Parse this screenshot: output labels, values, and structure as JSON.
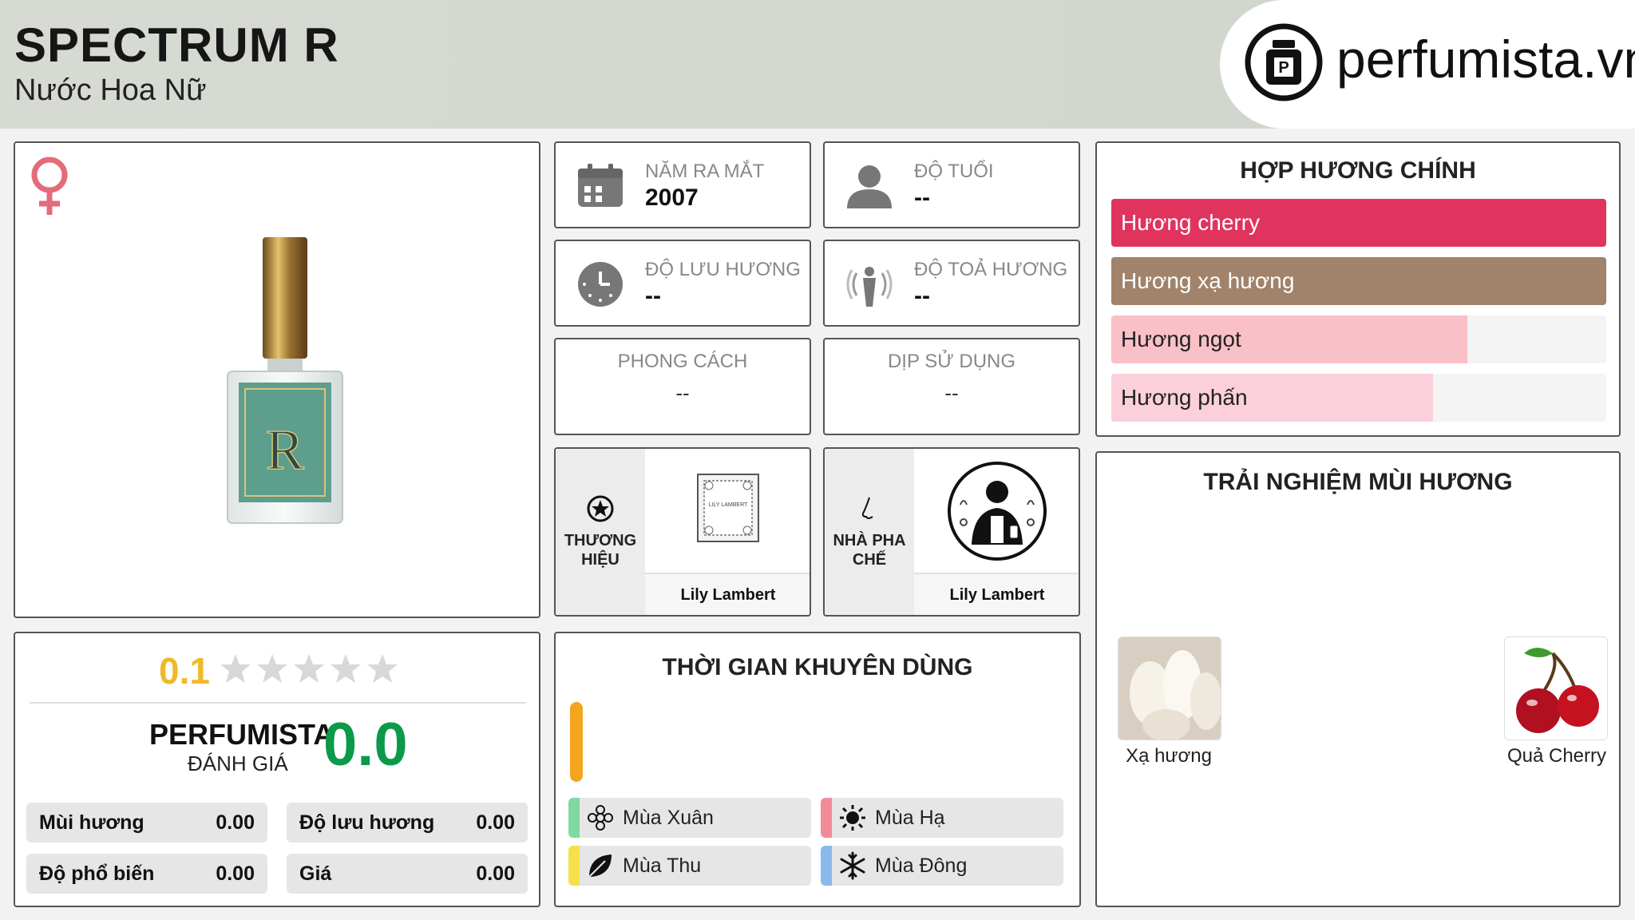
{
  "header": {
    "title": "SPECTRUM R",
    "subtitle": "Nước Hoa Nữ",
    "logo_text": "perfumista.vn"
  },
  "rating": {
    "user_score": "0.1",
    "stars_filled": 0,
    "stars_total": 5,
    "label": "PERFUMISTA",
    "sublabel": "ĐÁNH GIÁ",
    "score": "0.0",
    "metrics": [
      {
        "label": "Mùi hương",
        "value": "0.00"
      },
      {
        "label": "Độ lưu hương",
        "value": "0.00"
      },
      {
        "label": "Độ phổ biến",
        "value": "0.00"
      },
      {
        "label": "Giá",
        "value": "0.00"
      }
    ]
  },
  "info": {
    "release": {
      "label": "NĂM RA MẮT",
      "value": "2007"
    },
    "age": {
      "label": "ĐỘ TUỔI",
      "value": "--"
    },
    "longevity": {
      "label": "ĐỘ LƯU HƯƠNG",
      "value": "--"
    },
    "sillage": {
      "label": "ĐỘ TOẢ HƯƠNG",
      "value": "--"
    },
    "style": {
      "label": "PHONG CÁCH",
      "value": "--"
    },
    "occasion": {
      "label": "DỊP SỬ DỤNG",
      "value": "--"
    }
  },
  "brand": {
    "label": "THƯƠNG HIỆU",
    "name": "Lily Lambert",
    "logo_text": "LILY LAMBERT"
  },
  "perfumer": {
    "label": "NHÀ PHA CHẾ",
    "name": "Lily Lambert"
  },
  "time": {
    "title": "THỜI GIAN KHUYÊN DÙNG",
    "seasons": [
      {
        "label": "Mùa Xuân",
        "color": "#7fd9a0",
        "icon": "flower-icon"
      },
      {
        "label": "Mùa Hạ",
        "color": "#f28b99",
        "icon": "sun-icon"
      },
      {
        "label": "Mùa Thu",
        "color": "#f5e14a",
        "icon": "leaf-icon"
      },
      {
        "label": "Mùa Đông",
        "color": "#8ab8ea",
        "icon": "snowflake-icon"
      }
    ]
  },
  "accords": {
    "title": "HỢP HƯƠNG CHÍNH",
    "items": [
      {
        "label": "Hương cherry",
        "color": "#e0345f",
        "level": 1.0
      },
      {
        "label": "Hương xạ hương",
        "color": "#a0836a",
        "level": 1.0
      },
      {
        "label": "Hương ngọt",
        "color": "#f9c0c8",
        "level": 0.72
      },
      {
        "label": "Hương phấn",
        "color": "#fbd0da",
        "level": 0.65
      }
    ]
  },
  "experience": {
    "title": "TRẢI NGHIỆM MÙI HƯƠNG",
    "notes": [
      {
        "label": "Xạ hương"
      },
      {
        "label": "Quả Cherry"
      }
    ]
  }
}
